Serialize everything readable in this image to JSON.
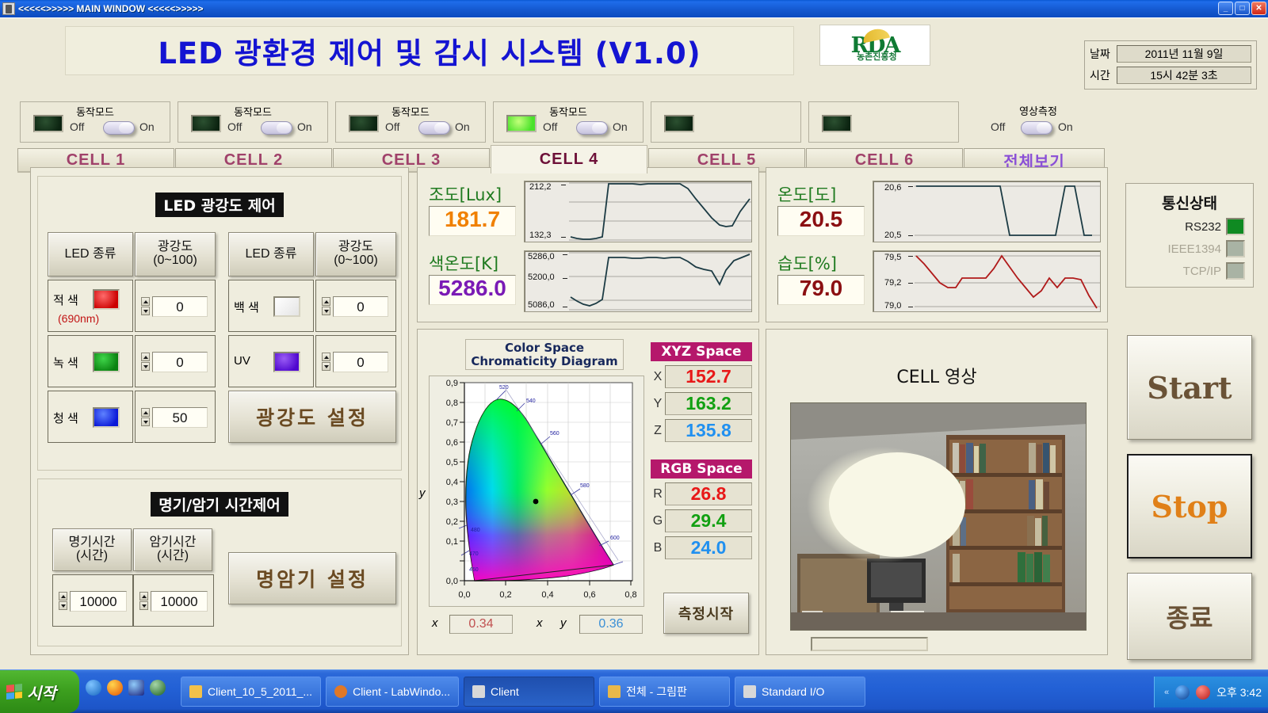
{
  "window": {
    "title": "<<<<<>>>>> MAIN WINDOW <<<<<>>>>>",
    "minimize": "_",
    "maximize": "□",
    "close": "✕"
  },
  "header": {
    "app_title": "LED 광환경 제어 및 감시 시스템 (V1.0)",
    "logo_text": "RDA",
    "logo_subtext": "농촌진흥청",
    "date_label": "날짜",
    "date_value": "2011년 11월 9일",
    "time_label": "시간",
    "time_value": "15시 42분 3초"
  },
  "mode_panels": [
    {
      "label": "동작모드",
      "off": "Off",
      "on": "On",
      "led_on": false,
      "has_switch": true
    },
    {
      "label": "동작모드",
      "off": "Off",
      "on": "On",
      "led_on": false,
      "has_switch": true
    },
    {
      "label": "동작모드",
      "off": "Off",
      "on": "On",
      "led_on": false,
      "has_switch": true
    },
    {
      "label": "동작모드",
      "off": "Off",
      "on": "On",
      "led_on": true,
      "has_switch": true
    },
    {
      "label": "",
      "off": "",
      "on": "",
      "led_on": false,
      "has_switch": false
    },
    {
      "label": "",
      "off": "",
      "on": "",
      "led_on": false,
      "has_switch": false
    }
  ],
  "video_toggle": {
    "label": "영상측정",
    "off": "Off",
    "on": "On"
  },
  "tabs": [
    {
      "label": "CELL 1",
      "selected": false
    },
    {
      "label": "CELL 2",
      "selected": false
    },
    {
      "label": "CELL 3",
      "selected": false
    },
    {
      "label": "CELL 4",
      "selected": true
    },
    {
      "label": "CELL 5",
      "selected": false
    },
    {
      "label": "CELL 6",
      "selected": false
    },
    {
      "label": "전체보기",
      "selected": false
    }
  ],
  "intensity": {
    "title": "LED 광강도 제어",
    "col_type_label": "LED 종류",
    "col_value_label": "광강도\n(0~100)",
    "col_value_line1": "광강도",
    "col_value_line2": "(0~100)",
    "set_button": "광강도  설정",
    "left_rows": [
      {
        "name": "적 색",
        "sub": "(690nm)",
        "color": "#e01010",
        "value": "0"
      },
      {
        "name": "녹 색",
        "sub": "",
        "color": "#0a8a12",
        "value": "0"
      },
      {
        "name": "청 색",
        "sub": "",
        "color": "#1226e8",
        "value": "50"
      }
    ],
    "right_rows": [
      {
        "name": "백 색",
        "sub": "",
        "color": "#f6f6f6",
        "value": "0"
      },
      {
        "name": "UV",
        "sub": "",
        "color": "#6a16e0",
        "value": "0"
      }
    ]
  },
  "timing": {
    "title": "명기/암기 시간제어",
    "light_label_l1": "명기시간",
    "light_label_l2": "(시간)",
    "dark_label_l1": "암기시간",
    "dark_label_l2": "(시간)",
    "light_value": "10000",
    "dark_value": "10000",
    "set_button": "명암기  설정"
  },
  "sensors": {
    "lux": {
      "label": "조도[Lux]",
      "value": "181.7",
      "color": "#f08000",
      "ymax": "212,2",
      "ymin": "132,3"
    },
    "cct": {
      "label": "색온도[K]",
      "value": "5286.0",
      "color": "#7a1ab5",
      "ymax": "5286,0",
      "ymid": "5200,0",
      "ymin": "5086,0"
    },
    "temp": {
      "label": "온도[도]",
      "value": "20.5",
      "color": "#8b0f12",
      "ymax": "20,6",
      "ymin": "20,5"
    },
    "hum": {
      "label": "습도[%]",
      "value": "79.0",
      "color": "#8b0f12",
      "ymax": "79,5",
      "ymid": "79,2",
      "ymin": "79,0"
    }
  },
  "chart_data": [
    {
      "type": "line",
      "title": "조도[Lux]",
      "ylabel": "Lux",
      "ylim": [
        132.3,
        212.2
      ],
      "yticks": [
        "132,3",
        "212,2"
      ],
      "grid": true,
      "series": [
        {
          "name": "조도",
          "color": "#1c3b44",
          "values": [
            136,
            134,
            133,
            133,
            134,
            135,
            212,
            212,
            212,
            212,
            211,
            212,
            212,
            212,
            212,
            212,
            207,
            197,
            186,
            176,
            168,
            166,
            167,
            180,
            193
          ]
        }
      ]
    },
    {
      "type": "line",
      "title": "색온도[K]",
      "ylabel": "K",
      "ylim": [
        5086.0,
        5286.0
      ],
      "yticks": [
        "5086,0",
        "5200,0",
        "5286,0"
      ],
      "grid": true,
      "series": [
        {
          "name": "색온도",
          "color": "#1c3b44",
          "values": [
            5106,
            5096,
            5090,
            5088,
            5092,
            5100,
            5268,
            5269,
            5268,
            5267,
            5267,
            5268,
            5268,
            5267,
            5268,
            5269,
            5255,
            5240,
            5232,
            5228,
            5196,
            5230,
            5258,
            5268,
            5282
          ]
        }
      ]
    },
    {
      "type": "line",
      "title": "온도[도]",
      "ylabel": "도",
      "ylim": [
        20.5,
        20.6
      ],
      "yticks": [
        "20,5",
        "20,6"
      ],
      "grid": true,
      "series": [
        {
          "name": "온도",
          "color": "#1c3b44",
          "values": [
            20.6,
            20.6,
            20.6,
            20.6,
            20.6,
            20.6,
            20.6,
            20.6,
            20.6,
            20.6,
            20.6,
            20.6,
            20.5,
            20.5,
            20.5,
            20.5,
            20.5,
            20.5,
            20.5,
            20.6,
            20.6,
            20.6,
            20.5
          ]
        }
      ]
    },
    {
      "type": "line",
      "title": "습도[%]",
      "ylabel": "%",
      "ylim": [
        79.0,
        79.5
      ],
      "yticks": [
        "79,0",
        "79,2",
        "79,5"
      ],
      "grid": true,
      "series": [
        {
          "name": "습도",
          "color": "#b01a1a",
          "values": [
            79.5,
            79.42,
            79.32,
            79.22,
            79.17,
            79.17,
            79.27,
            79.27,
            79.27,
            79.27,
            79.35,
            79.5,
            79.37,
            79.27,
            79.18,
            79.1,
            79.17,
            79.28,
            79.19,
            79.28,
            79.28,
            79.27,
            79.12,
            79.0
          ]
        }
      ]
    },
    {
      "type": "scatter",
      "title": "Color Space Chromaticity Diagram",
      "xlabel": "x",
      "ylabel": "y",
      "xlim": [
        0.0,
        0.8
      ],
      "ylim": [
        0.0,
        0.9
      ],
      "xticks": [
        "0,0",
        "0,2",
        "0,4",
        "0,6",
        "0,8"
      ],
      "yticks": [
        "0,0",
        "0,1",
        "0,2",
        "0,3",
        "0,4",
        "0,5",
        "0,6",
        "0,7",
        "0,8",
        "0,9"
      ],
      "wavelength_labels": [
        "520",
        "540",
        "560",
        "580",
        "460",
        "470",
        "480",
        "450"
      ],
      "points": [
        {
          "x": 0.34,
          "y": 0.36,
          "label": "measured point"
        }
      ],
      "grid": true
    }
  ],
  "chroma": {
    "title_line1": "Color Space",
    "title_line2": "Chromaticity Diagram",
    "x_axis_label": "x",
    "y_axis_label": "y",
    "x_ticks": [
      "0,0",
      "0,2",
      "0,4",
      "0,6",
      "0,8"
    ],
    "y_ticks": [
      "0,9",
      "0,8",
      "0,7",
      "0,6",
      "0,5",
      "0,4",
      "0,3",
      "0,2",
      "0,1",
      "0,0"
    ],
    "wl_labels": [
      "520",
      "540",
      "560",
      "580",
      "480",
      "470",
      "450"
    ],
    "coord_x_label": "x",
    "coord_x_value": "0.34",
    "coord_y_label_left": "x",
    "coord_y_label": "y",
    "coord_y_value": "0.36"
  },
  "color_spaces": {
    "xyz_title": "XYZ Space",
    "rgb_title": "RGB Space",
    "xyz": [
      {
        "name": "X",
        "value": "152.7",
        "color": "#e81818"
      },
      {
        "name": "Y",
        "value": "163.2",
        "color": "#12a012"
      },
      {
        "name": "Z",
        "value": "135.8",
        "color": "#2090f0"
      }
    ],
    "rgb": [
      {
        "name": "R",
        "value": "26.8",
        "color": "#e81818"
      },
      {
        "name": "G",
        "value": "29.4",
        "color": "#12a012"
      },
      {
        "name": "B",
        "value": "24.0",
        "color": "#2090f0"
      }
    ],
    "measure_button": "측정시작"
  },
  "cell_video": {
    "title": "CELL 영상"
  },
  "right_rail": {
    "comm_title": "통신상태",
    "comm_rows": [
      {
        "name": "RS232",
        "active": true
      },
      {
        "name": "IEEE1394",
        "active": false
      },
      {
        "name": "TCP/IP",
        "active": false
      }
    ],
    "start_button": "Start",
    "stop_button": "Stop",
    "exit_button": "종료",
    "start_color": "#6a5236",
    "stop_color": "#e08018",
    "exit_color": "#6a5236"
  },
  "taskbar": {
    "start_label": "시작",
    "tasks": [
      {
        "label": "Client_10_5_2011_...",
        "active": false,
        "icon_color": "#f2c14a"
      },
      {
        "label": "Client - LabWindo...",
        "active": false,
        "icon_color": "#e07828"
      },
      {
        "label": "Client",
        "active": true,
        "icon_color": "#d8d8d8"
      },
      {
        "label": "전체 - 그림판",
        "active": false,
        "icon_color": "#e8b84a"
      },
      {
        "label": "Standard I/O",
        "active": false,
        "icon_color": "#d8d8d8"
      }
    ],
    "clock": "오후 3:42"
  }
}
